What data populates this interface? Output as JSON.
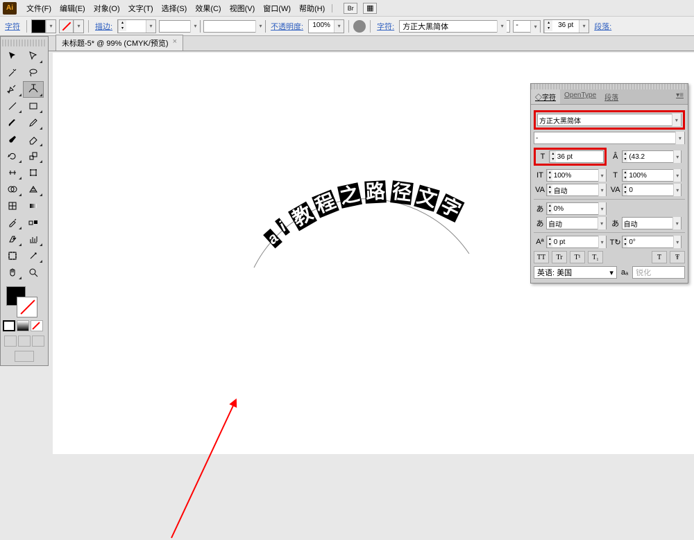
{
  "app": {
    "icon": "Ai"
  },
  "menu": {
    "items": [
      "文件(F)",
      "编辑(E)",
      "对象(O)",
      "文字(T)",
      "选择(S)",
      "效果(C)",
      "视图(V)",
      "窗口(W)",
      "帮助(H)"
    ],
    "ext1": "Br",
    "ext2": "▦"
  },
  "optbar": {
    "char_label": "字符",
    "stroke_label": "描边:",
    "opacity_label": "不透明度:",
    "opacity_value": "100%",
    "char_link": "字符:",
    "font_name": "方正大黑简体",
    "font_style": "-",
    "font_size": "36 pt",
    "para_label": "段落:"
  },
  "document": {
    "tab_title": "未标题-5* @ 99% (CMYK/预览)",
    "close": "×"
  },
  "artwork": {
    "path_text_chars": [
      "a",
      "i",
      "教",
      "程",
      "之",
      "路",
      "径",
      "文",
      "字"
    ]
  },
  "charpanel": {
    "tabs": [
      "◇字符",
      "OpenType",
      "段落"
    ],
    "font_family": "方正大黑简体",
    "font_style": "-",
    "font_size": "36 pt",
    "leading": "(43.2",
    "hscale": "100%",
    "vscale": "100%",
    "kerning": "自动",
    "tracking": "0",
    "baseline_pct": "0%",
    "auto1": "自动",
    "auto2": "自动",
    "baseline_shift": "0 pt",
    "rotation": "0°",
    "tt": [
      "TT",
      "Tr",
      "T¹",
      "T₁",
      "T",
      "Ŧ"
    ],
    "language": "英语: 美国",
    "aa_label": "aₐ",
    "aa_value": "锐化"
  }
}
